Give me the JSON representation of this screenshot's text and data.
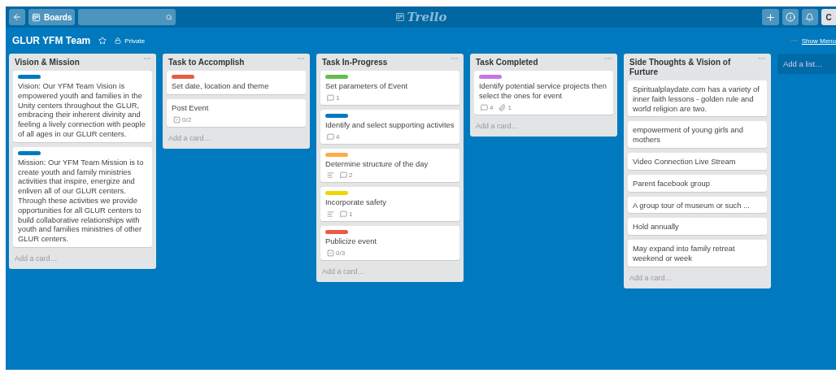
{
  "header": {
    "boards_button": "Boards",
    "logo": "Trello",
    "avatar": "C"
  },
  "board": {
    "title": "GLUR YFM Team",
    "starred": false,
    "visibility": "Private",
    "menu_link": "Show Menu"
  },
  "lists": [
    {
      "title": "Vision & Mission",
      "cards": [
        {
          "color": "#0079bf",
          "text": "Vision: Our YFM Team Vision is empowered youth and families in the Unity centers throughout the GLUR, embracing their inherent divinity and feeling a lively connection with people of all ages in our GLUR centers."
        },
        {
          "color": "#0079bf",
          "text": "Mission: Our YFM Team Mission is to create youth and family ministries activities that inspire, energize and enliven all of our GLUR centers. Through these activities we provide opportunities for all GLUR centers to build collaborative relationships with youth and families ministries of other GLUR centers."
        }
      ],
      "add": "Add a card…"
    },
    {
      "title": "Task to Accomplish",
      "cards": [
        {
          "color": "#eb5a46",
          "text": "Set date, location and theme"
        },
        {
          "text": "Post Event",
          "badges": [
            {
              "kind": "checklist",
              "text": "0/2"
            }
          ]
        }
      ],
      "add": "Add a card…"
    },
    {
      "title": "Task In-Progress",
      "cards": [
        {
          "color": "#61bd4f",
          "text": "Set parameters of Event",
          "badges": [
            {
              "kind": "comments",
              "text": "1"
            }
          ]
        },
        {
          "color": "#0079bf",
          "text": "Identify and select supporting activites",
          "badges": [
            {
              "kind": "comments",
              "text": "4"
            }
          ]
        },
        {
          "color": "#ffab4a",
          "text": "Determine structure of the day",
          "badges": [
            {
              "kind": "description"
            },
            {
              "kind": "comments",
              "text": "2"
            }
          ]
        },
        {
          "color": "#f2d600",
          "text": "Incorporate safety",
          "badges": [
            {
              "kind": "description"
            },
            {
              "kind": "comments",
              "text": "1"
            }
          ]
        },
        {
          "color": "#eb5a46",
          "text": "Publicize event",
          "badges": [
            {
              "kind": "checklist",
              "text": "0/3"
            }
          ]
        }
      ],
      "add": "Add a card…"
    },
    {
      "title": "Task Completed",
      "cards": [
        {
          "color": "#c377e0",
          "text": "Identify potential service projects then select the ones for event",
          "badges": [
            {
              "kind": "comments",
              "text": "4"
            },
            {
              "kind": "attachment",
              "text": "1"
            }
          ]
        }
      ],
      "add": "Add a card…"
    },
    {
      "title": "Side Thoughts & Vision of Furture",
      "cards": [
        {
          "text": "Spiritualplaydate.com has a variety of inner faith lessons - golden rule and world religion are two."
        },
        {
          "text": "empowerment of young girls and mothers"
        },
        {
          "text": "Video Connection Live Stream"
        },
        {
          "text": "Parent facebook group"
        },
        {
          "text": "A group tour of museum or such ..."
        },
        {
          "text": "Hold annually"
        },
        {
          "text": "May expand into family retreat weekend or week"
        }
      ],
      "add": "Add a card…"
    }
  ],
  "add_list": "Add a list…"
}
